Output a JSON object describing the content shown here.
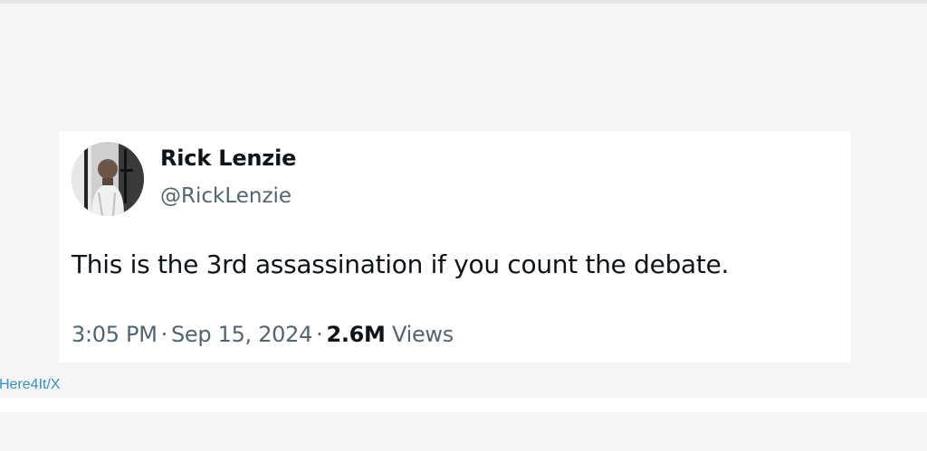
{
  "tweet": {
    "display_name": "Rick Lenzie",
    "handle": "@RickLenzie",
    "text": "This is the 3rd assassination if you count the debate.",
    "time": "3:05 PM",
    "date": "Sep 15, 2024",
    "separator": "·",
    "views_count": "2.6M",
    "views_label": "Views",
    "avatar_icon": "profile-photo"
  },
  "credit": {
    "text": "Here4It/X"
  },
  "colors": {
    "primary_text": "#0f1419",
    "secondary_text": "#536471",
    "credit_link": "#3a8fc4",
    "page_background": "#f5f5f7",
    "card_background": "#ffffff"
  }
}
